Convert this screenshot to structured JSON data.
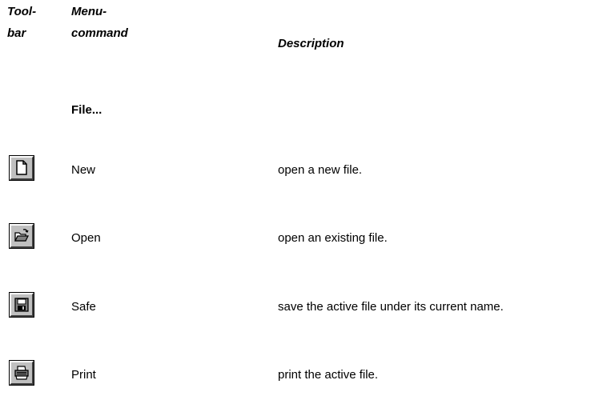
{
  "headers": {
    "toolbar": "Tool-\nbar",
    "menu_command": "Menu-\ncommand",
    "description": "Description"
  },
  "section": {
    "title": "File..."
  },
  "rows": [
    {
      "icon": "new-file-icon",
      "command": "New",
      "description": "open a new file."
    },
    {
      "icon": "open-folder-icon",
      "command": "Open",
      "description": "open an existing file."
    },
    {
      "icon": "floppy-disk-icon",
      "command": "Safe",
      "description": "save the active file under its current name."
    },
    {
      "icon": "printer-icon",
      "command": "Print",
      "description": "print the active file."
    }
  ],
  "colors": {
    "button_face": "#c0c0c0",
    "button_highlight": "#ffffff",
    "button_shadow": "#404040",
    "text": "#000000"
  }
}
